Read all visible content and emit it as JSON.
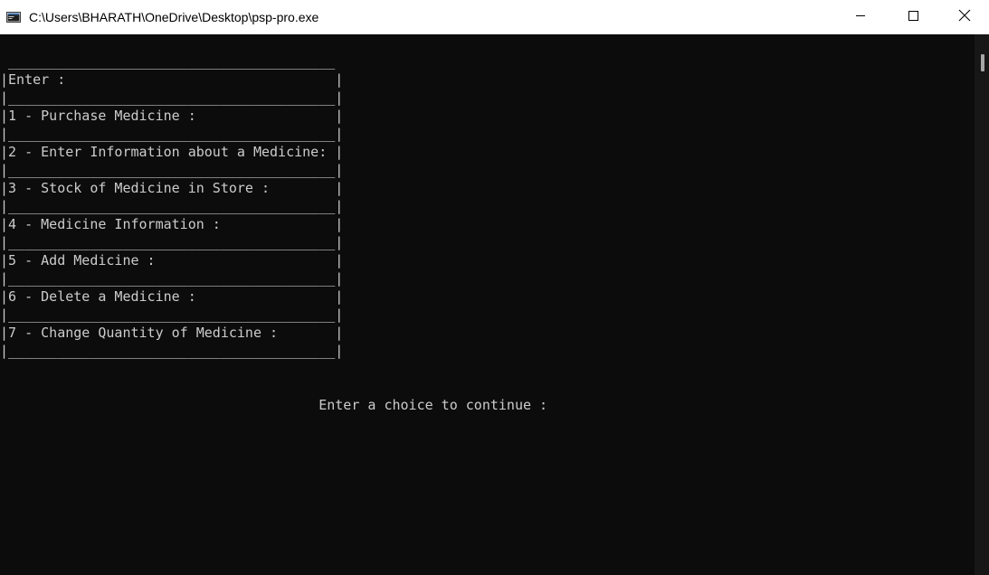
{
  "window": {
    "title": "C:\\Users\\BHARATH\\OneDrive\\Desktop\\psp-pro.exe",
    "icon": "console-app-icon",
    "controls": {
      "minimize_icon": "minimize-icon",
      "maximize_icon": "maximize-icon",
      "close_icon": "close-icon"
    }
  },
  "console": {
    "lines": [
      " ________________________________________",
      "|Enter :                                 |",
      "|________________________________________|",
      "|1 - Purchase Medicine :                 |",
      "|________________________________________|",
      "|2 - Enter Information about a Medicine: |",
      "|________________________________________|",
      "|3 - Stock of Medicine in Store :        |",
      "|________________________________________|",
      "|4 - Medicine Information :              |",
      "|________________________________________|",
      "|5 - Add Medicine :                      |",
      "|________________________________________|",
      "|6 - Delete a Medicine :                 |",
      "|________________________________________|",
      "|7 - Change Quantity of Medicine :       |",
      "|________________________________________|",
      "",
      "",
      "                                       Enter a choice to continue : "
    ]
  },
  "colors": {
    "console_background": "#0c0c0c",
    "console_text": "#cccccc",
    "titlebar_background": "#ffffff"
  }
}
